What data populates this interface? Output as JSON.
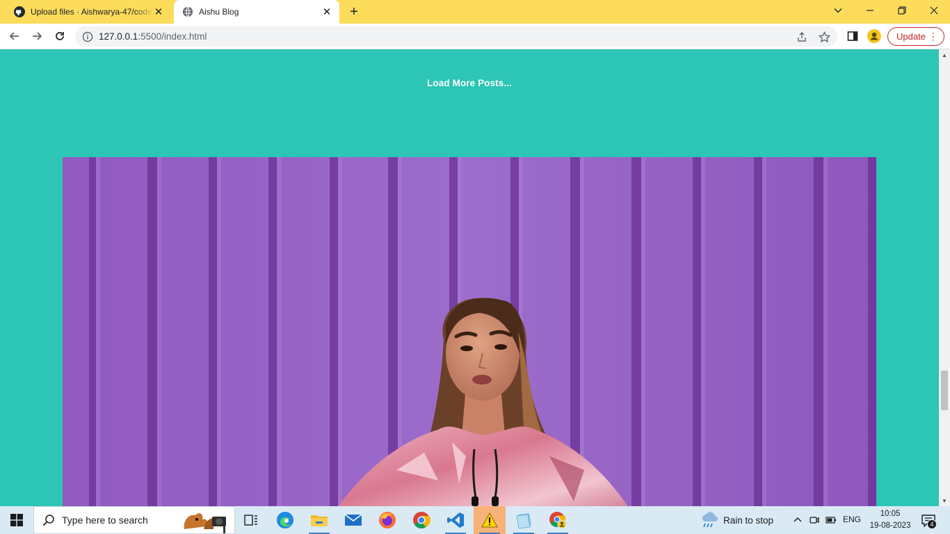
{
  "browser": {
    "chrome_color": "#fddc5c",
    "tabs": [
      {
        "title": "Upload files · Aishwarya-47/code",
        "icon": "github-icon",
        "active": false
      },
      {
        "title": "Aishu Blog",
        "icon": "globe-icon",
        "active": true
      }
    ],
    "new_tab_label": "+",
    "url_host": "127.0.0.1",
    "url_rest": ":5500/index.html",
    "update_label": "Update"
  },
  "page": {
    "background_color": "#2cc5b6",
    "load_more_label": "Load More Posts...",
    "hero_image": "woman-in-pink-metallic-jacket-against-purple-wall"
  },
  "taskbar": {
    "search_placeholder": "Type here to search",
    "apps": [
      "task-view-icon",
      "edge-icon",
      "file-explorer-icon",
      "mail-icon",
      "firefox-icon",
      "chrome-icon",
      "vscode-icon",
      "warning-app-icon",
      "notepad-icon",
      "chrome-profile-icon"
    ],
    "weather_text": "Rain to stop",
    "language": "ENG",
    "time": "10:05",
    "date": "19-08-2023",
    "notification_count": "4"
  }
}
